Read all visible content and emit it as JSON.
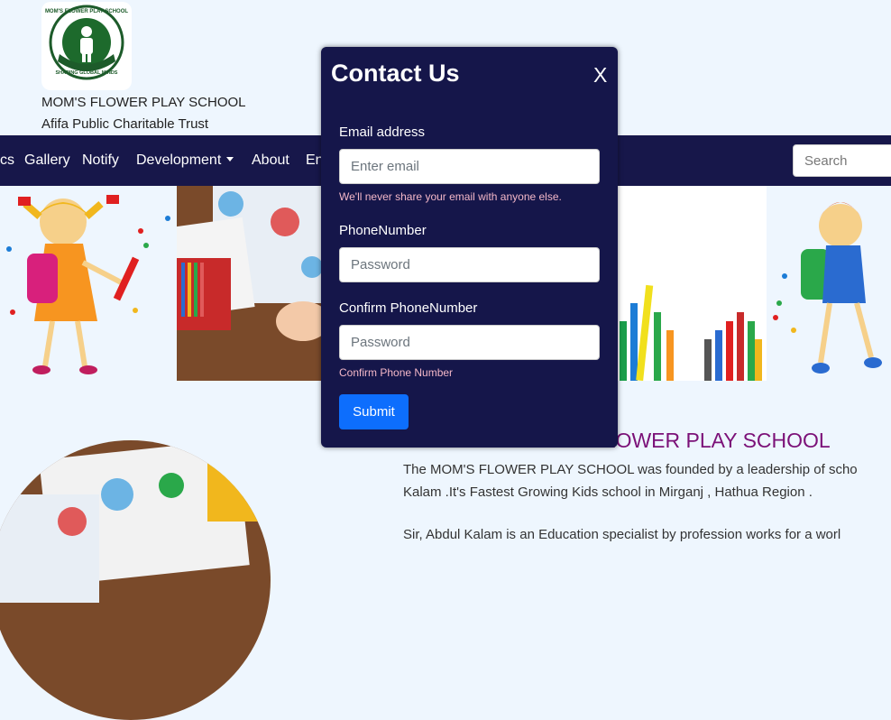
{
  "header": {
    "school_name": "MOM'S FLOWER PLAY SCHOOL",
    "trust_name": "Afifa Public Charitable Trust",
    "logo_ring_text": "MOM'S FLOWER PLAY SCHOOL",
    "logo_motto": "SHAPING GLOBAL MINDS"
  },
  "nav": {
    "items": [
      "cs",
      "Gallery",
      "Notify",
      "Development",
      "About",
      "En"
    ],
    "search_placeholder": "Search"
  },
  "main": {
    "welcome_title": "Welcome to MOM'S FLOWER PLAY SCHOOL",
    "paragraph_1_line_1": "The MOM'S FLOWER PLAY SCHOOL was founded by a leadership of scho",
    "paragraph_1_line_2": "Kalam .It's Fastest Growing Kids school in Mirganj , Hathua Region .",
    "paragraph_2_line_1": "Sir, Abdul Kalam is an Education specialist by profession works for a worl"
  },
  "modal": {
    "title": "Contact Us",
    "close_label": "X",
    "email_label": "Email address",
    "email_placeholder": "Enter email",
    "email_help": "We'll never share your email with anyone else.",
    "phone_label": "PhoneNumber",
    "phone_placeholder": "Password",
    "confirm_label": "Confirm PhoneNumber",
    "confirm_placeholder": "Password",
    "confirm_help": "Confirm Phone Number",
    "submit_label": "Submit"
  },
  "colors": {
    "navbar": "#17174a",
    "modal_bg": "#15164a",
    "accent_blue": "#0d6efd",
    "title_purple": "#7b1178",
    "help_pink": "#f4b8c8",
    "page_bg": "#eef6fe"
  }
}
